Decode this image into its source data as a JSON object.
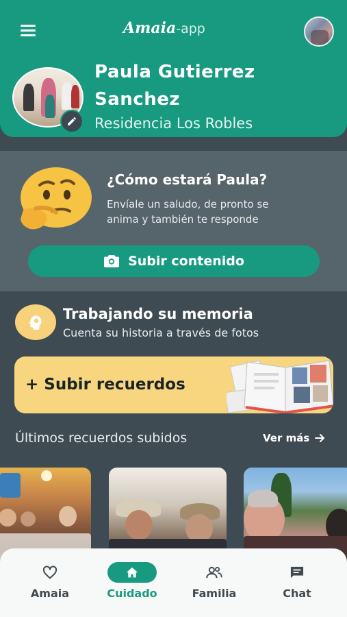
{
  "header": {
    "logo_main": "Amaia",
    "logo_sub": "-app",
    "menu_icon": "hamburger-menu-icon",
    "account_avatar": "user-avatar"
  },
  "profile": {
    "name_line1": "Paula Gutierrez",
    "name_line2": "Sanchez",
    "residence": "Residencia Los Robles",
    "edit_icon": "pencil-icon"
  },
  "status_panel": {
    "emoji": "thinking-face",
    "title": "¿Cómo estará Paula?",
    "text_line1": "Envíale un saludo, de pronto se",
    "text_line2": "anima y también te responde",
    "upload_button": {
      "icon": "camera-icon",
      "label": "Subir contenido"
    }
  },
  "memory": {
    "icon": "brain-head-icon",
    "title": "Trabajando su memoria",
    "subtitle": "Cuenta su historia a través de fotos",
    "upload_card_label": "+ Subir recuerdos",
    "latest_label": "Últimos recuerdos subidos",
    "see_more": "Ver más"
  },
  "bottom_nav": {
    "items": [
      {
        "label": "Amaia",
        "icon": "heart-icon",
        "active": false
      },
      {
        "label": "Cuidado",
        "icon": "home-icon",
        "active": true
      },
      {
        "label": "Familia",
        "icon": "people-icon",
        "active": false
      },
      {
        "label": "Chat",
        "icon": "chat-icon",
        "active": false
      }
    ]
  },
  "colors": {
    "primary": "#179a80",
    "background": "#3e4b52",
    "panel": "#56646b",
    "accent_yellow": "#f8d67f"
  }
}
